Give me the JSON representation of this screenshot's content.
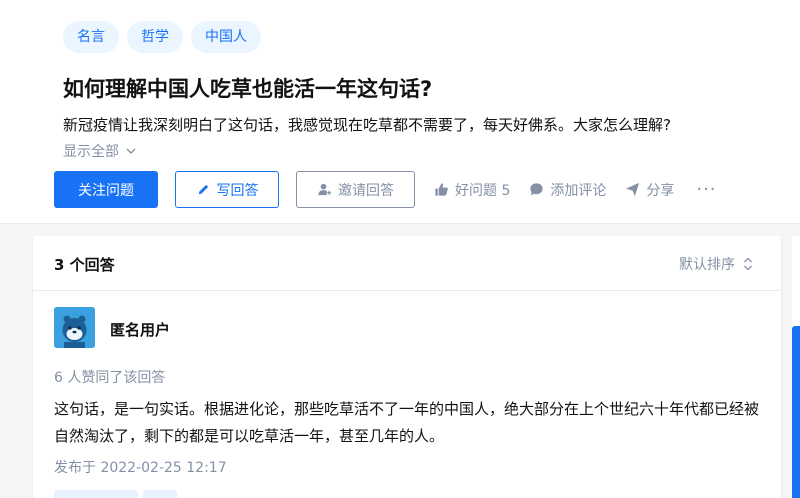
{
  "question": {
    "topics": [
      "名言",
      "哲学",
      "中国人"
    ],
    "title": "如何理解中国人吃草也能活一年这句话?",
    "detail": "新冠疫情让我深刻明白了这句话，我感觉现在吃草都不需要了，每天好佛系。大家怎么理解?",
    "show_all": "显示全部"
  },
  "actions": {
    "follow": "关注问题",
    "write": "写回答",
    "invite": "邀请回答",
    "good_question": "好问题 5",
    "comment": "添加评论",
    "share": "分享",
    "more": "···"
  },
  "answers": {
    "count": "3 个回答",
    "sort": "默认排序",
    "items": [
      {
        "author": "匿名用户",
        "votes": "6 人赞同了该回答",
        "content": "这句话，是一句实话。根据进化论，那些吃草活不了一年的中国人，绝大部分在上个世纪六十年代都已经被自然淘汰了，剩下的都是可以吃草活一年，甚至几年的人。",
        "time": "发布于 2022-02-25 12:17"
      }
    ]
  },
  "colors": {
    "brand_blue": "#1772f6",
    "muted": "#8590a6",
    "tag_bg": "#ebf5ff"
  }
}
